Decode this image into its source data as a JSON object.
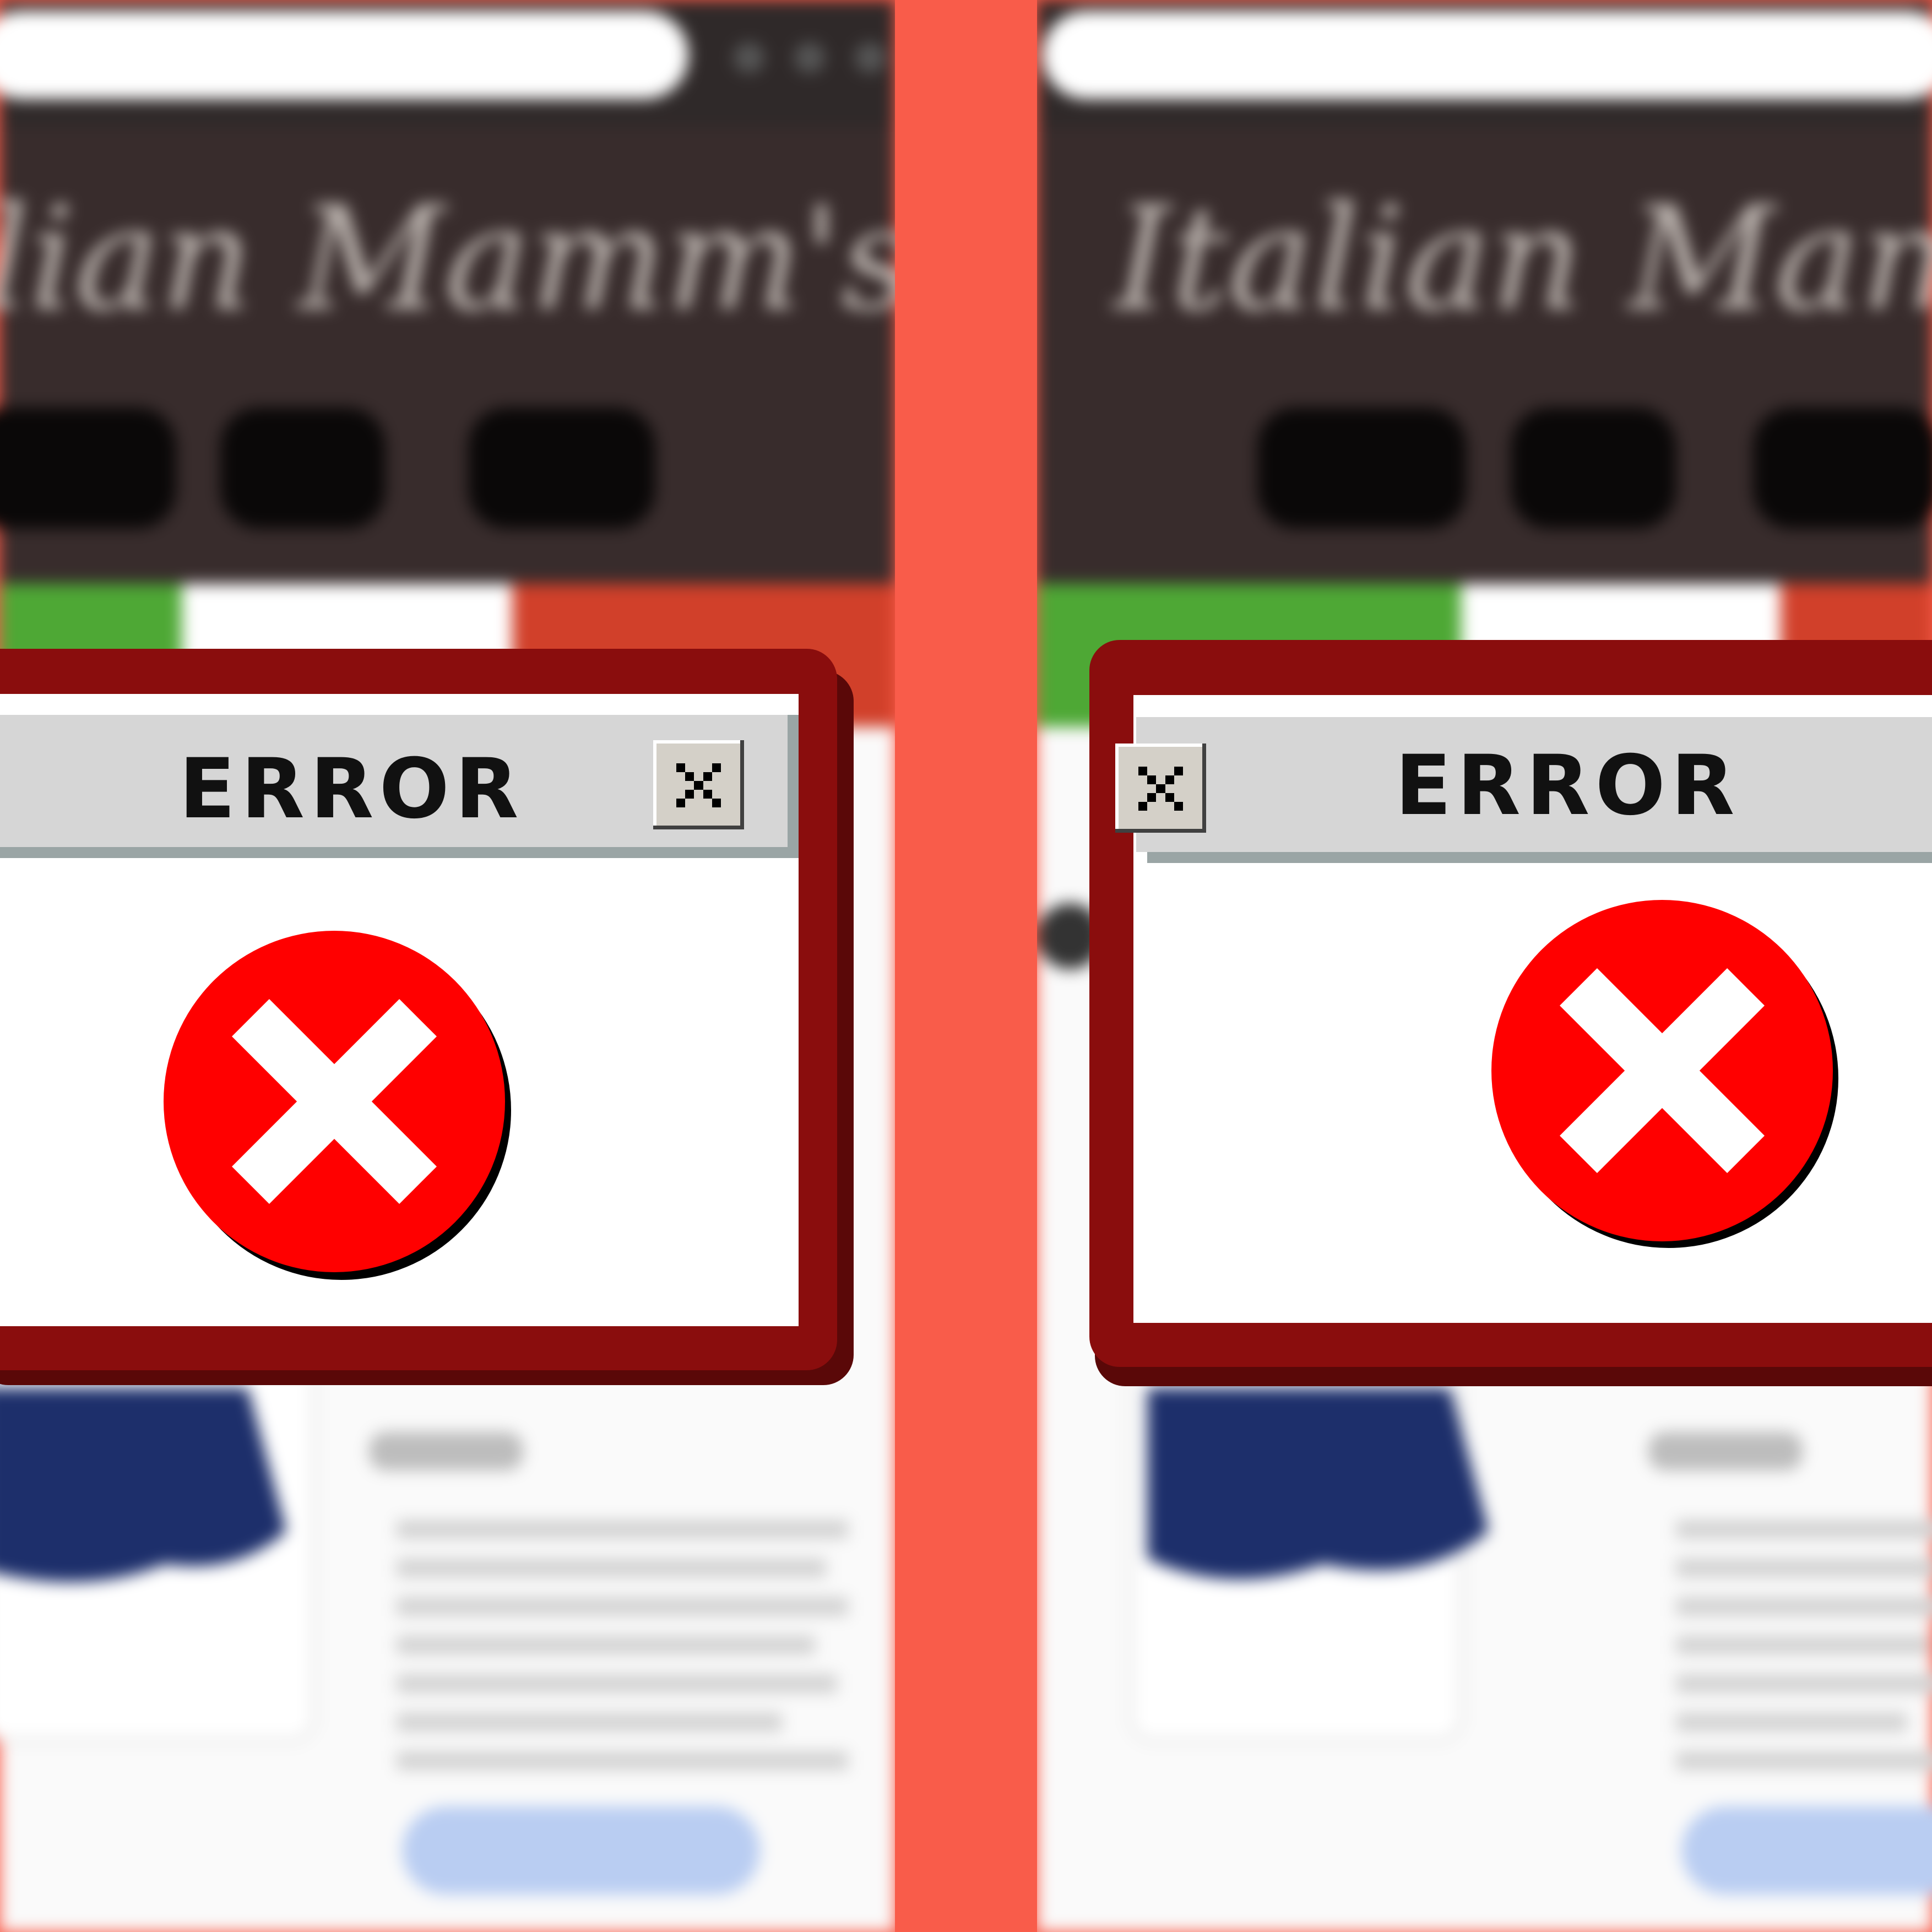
{
  "colors": {
    "divider": "#f95c4a",
    "dialog_frame": "#8a0d0d",
    "dialog_shadow": "#5a0808",
    "titlebar": "#d6d6d6",
    "titlebar_shadow": "#9aa5a5",
    "error_circle": "#ff0000",
    "site_header": "#382c2c",
    "flag_green": "#4ea835",
    "flag_white": "#ffffff",
    "flag_red": "#d1402a"
  },
  "panels": [
    {
      "id": "left",
      "dialog": {
        "title": "ERROR",
        "close_icon": "close-icon",
        "status_icon": "error-x-icon"
      }
    },
    {
      "id": "right",
      "dialog": {
        "title": "ERROR",
        "close_icon": "close-icon",
        "status_icon": "error-x-icon"
      }
    }
  ]
}
